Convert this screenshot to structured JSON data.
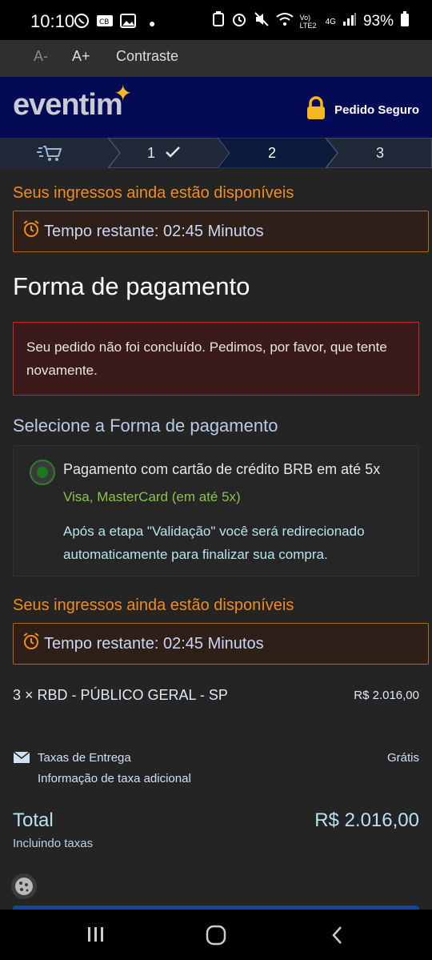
{
  "status_bar": {
    "time": "10:10",
    "battery": "93%",
    "network": "4G",
    "volte": "Vo) LTE2"
  },
  "accessibility": {
    "decrease": "A-",
    "increase": "A+",
    "contrast": "Contraste"
  },
  "header": {
    "logo": "eventim",
    "secure_label": "Pedido Seguro"
  },
  "steps": {
    "step1": "1",
    "step2": "2",
    "step3": "3"
  },
  "availability": {
    "message": "Seus ingressos ainda estão disponíveis",
    "timer_label": "Tempo restante: 02:45 Minutos"
  },
  "payment": {
    "title": "Forma de pagamento",
    "error": "Seu pedido não foi concluído. Pedimos, por favor, que tente novamente.",
    "select_title": "Selecione a Forma de pagamento",
    "option_title": "Pagamento com cartão de crédito BRB em até 5x",
    "option_subtitle": "Visa, MasterCard (em até 5x)",
    "option_note": "Após a etapa \"Validação\" você será redirecionado automaticamente para finalizar sua compra."
  },
  "order": {
    "item": "3 × RBD - PÚBLICO GERAL - SP",
    "item_price": "R$ 2.016,00",
    "delivery_label": "Taxas de Entrega",
    "delivery_info": "Informação de taxa adicional",
    "delivery_price": "Grátis",
    "total_label": "Total",
    "total_value": "R$ 2.016,00",
    "total_note": "Incluindo taxas"
  },
  "colors": {
    "header_bg": "#050a55",
    "accent_orange": "#f28c1e",
    "error_border": "#c62828",
    "success_green": "#8bc34a"
  }
}
